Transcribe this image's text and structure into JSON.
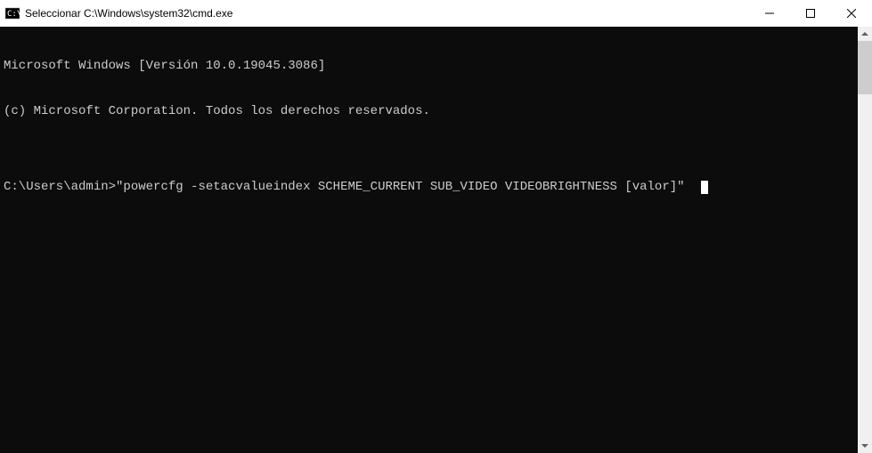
{
  "titlebar": {
    "title": "Seleccionar C:\\Windows\\system32\\cmd.exe"
  },
  "terminal": {
    "line1": "Microsoft Windows [Versión 10.0.19045.3086]",
    "line2": "(c) Microsoft Corporation. Todos los derechos reservados.",
    "blank": "",
    "prompt": "C:\\Users\\admin>",
    "command": "\"powercfg -setacvalueindex SCHEME_CURRENT SUB_VIDEO VIDEOBRIGHTNESS [valor]\""
  }
}
